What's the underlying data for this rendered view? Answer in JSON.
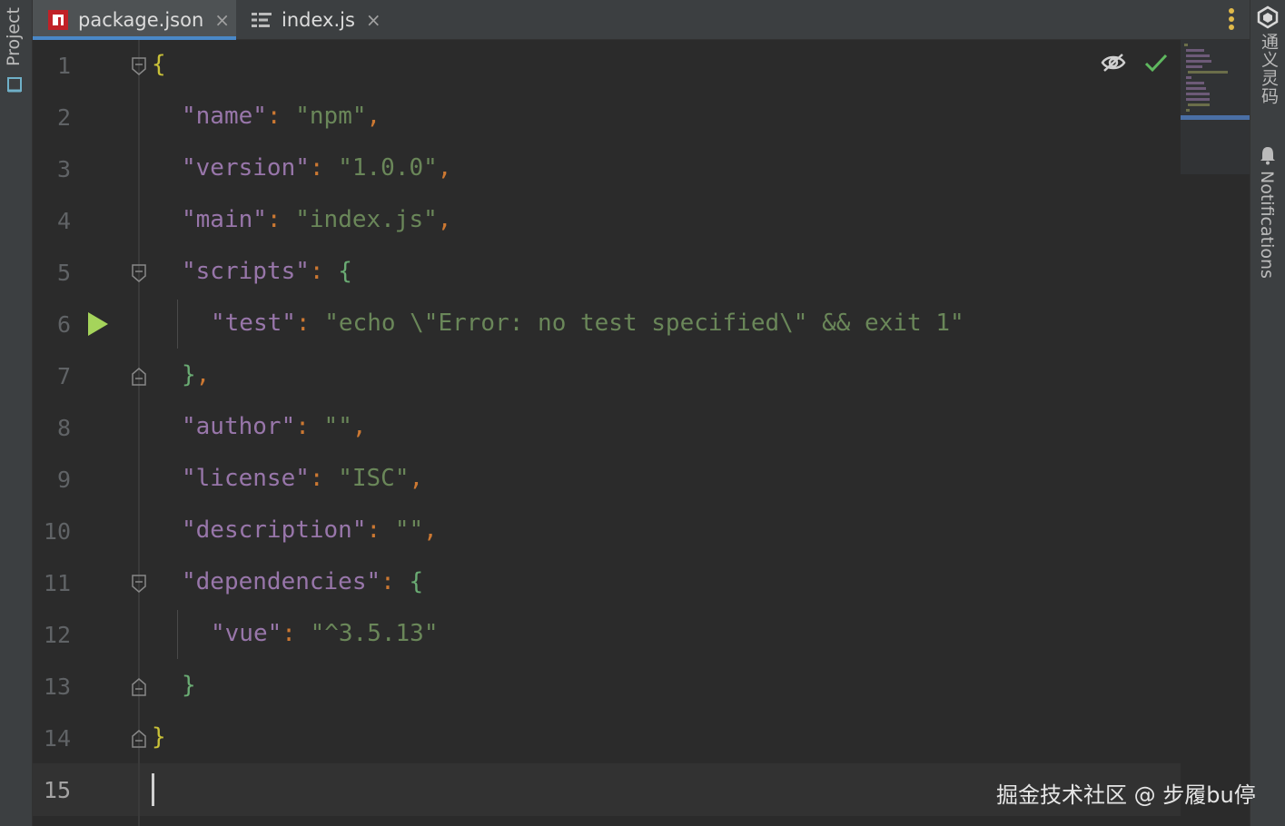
{
  "left_strip": {
    "project_label": "Project"
  },
  "tabs": [
    {
      "label": "package.json",
      "close": "×",
      "active": true,
      "icon": "npm-icon"
    },
    {
      "label": "index.js",
      "close": "×",
      "active": false,
      "icon": "structure-icon"
    }
  ],
  "right_strip": {
    "ai_label": "通义灵码",
    "notifications_label": "Notifications"
  },
  "editor": {
    "line_numbers": [
      "1",
      "2",
      "3",
      "4",
      "5",
      "6",
      "7",
      "8",
      "9",
      "10",
      "11",
      "12",
      "13",
      "14",
      "15"
    ],
    "current_line": 15,
    "lines": {
      "l1_open": "{",
      "l2_key": "\"name\"",
      "l2_colon": ":",
      "l2_val": "\"npm\"",
      "l2_comma": ",",
      "l3_key": "\"version\"",
      "l3_colon": ":",
      "l3_val": "\"1.0.0\"",
      "l3_comma": ",",
      "l4_key": "\"main\"",
      "l4_colon": ":",
      "l4_val": "\"index.js\"",
      "l4_comma": ",",
      "l5_key": "\"scripts\"",
      "l5_colon": ":",
      "l5_open": "{",
      "l6_key": "\"test\"",
      "l6_colon": ":",
      "l6_val": "\"echo \\\"Error: no test specified\\\" && exit 1\"",
      "l7_close": "}",
      "l7_comma": ",",
      "l8_key": "\"author\"",
      "l8_colon": ":",
      "l8_val": "\"\"",
      "l8_comma": ",",
      "l9_key": "\"license\"",
      "l9_colon": ":",
      "l9_val": "\"ISC\"",
      "l9_comma": ",",
      "l10_key": "\"description\"",
      "l10_colon": ":",
      "l10_val": "\"\"",
      "l10_comma": ",",
      "l11_key": "\"dependencies\"",
      "l11_colon": ":",
      "l11_open": "{",
      "l12_key": "\"vue\"",
      "l12_colon": ":",
      "l12_val": "\"^3.5.13\"",
      "l13_close": "}",
      "l14_close": "}"
    }
  },
  "watermark": "掘金技术社区 @ 步履bu停",
  "colors": {
    "key": "#9876aa",
    "string": "#6a8759",
    "punctuation": "#cc7832",
    "tab_underline": "#4a88c7",
    "run": "#a5d45b"
  }
}
